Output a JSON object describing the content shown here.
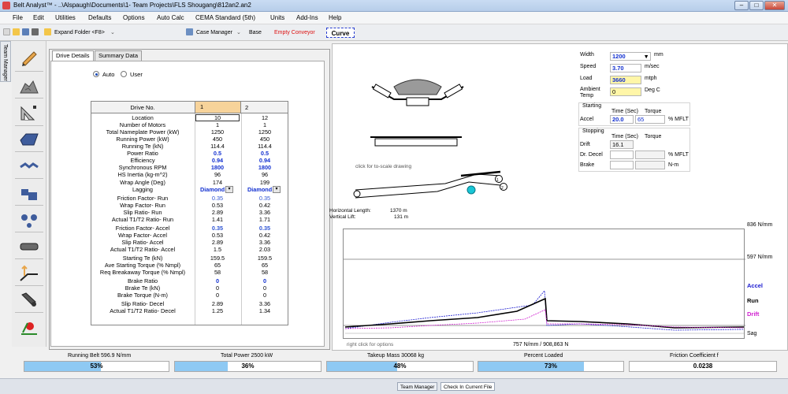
{
  "window": {
    "title": "Belt Analyst™ - ..\\Alspaugh\\Documents\\1- Team Projects\\FLS Shougang\\812an2.an2"
  },
  "menu": [
    "File",
    "Edit",
    "Utilities",
    "Defaults",
    "Options",
    "Auto Calc",
    "CEMA Standard (5th)",
    "Units",
    "Add-Ins",
    "Help"
  ],
  "toolbar": {
    "expand_folder": "Expand Folder <F8>",
    "case_manager": "Case Manager",
    "base": "Base",
    "empty_conveyor": "Empty Conveyor",
    "curve": "Curve"
  },
  "sidetab": "Team Manager",
  "left_icons": [
    "pencil-icon",
    "rock-pile-icon",
    "ruler-icon",
    "hopper-icon",
    "belt-link-icon",
    "pipe-icon",
    "pulley-set-icon",
    "roller-icon",
    "take-up-icon",
    "brake-icon",
    "alarm-icon"
  ],
  "tabs": {
    "drive_details": "Drive Details",
    "summary_data": "Summary Data"
  },
  "mode": {
    "auto": "Auto",
    "user": "User"
  },
  "drive_table": {
    "header": "Drive No.",
    "col1": "1",
    "col2": "2",
    "rows": [
      {
        "label": "Location",
        "v1": "10",
        "v2": "12"
      },
      {
        "label": "Number of Motors",
        "v1": "1",
        "v2": "1"
      },
      {
        "label": "Total Nameplate Power (kW)",
        "v1": "1250",
        "v2": "1250"
      },
      {
        "label": "Running Power (kW)",
        "v1": "450",
        "v2": "450"
      },
      {
        "label": "Running Te (kN)",
        "v1": "114.4",
        "v2": "114.4"
      },
      {
        "label": "Power Ratio",
        "v1": "0.5",
        "v2": "0.5"
      },
      {
        "label": "Efficiency",
        "v1": "0.94",
        "v2": "0.94"
      },
      {
        "label": "Synchronous RPM",
        "v1": "1800",
        "v2": "1800"
      },
      {
        "label": "HS Inertia (kg-m^2)",
        "v1": "96",
        "v2": "96"
      },
      {
        "label": "Wrap Angle (Deg)",
        "v1": "174",
        "v2": "199"
      },
      {
        "label": "Lagging",
        "v1": "Diamond",
        "v2": "Diamond"
      },
      {
        "label": "Friction Factor- Run",
        "v1": "0.35",
        "v2": "0.35"
      },
      {
        "label": "Wrap Factor- Run",
        "v1": "0.53",
        "v2": "0.42"
      },
      {
        "label": "Slip Ratio- Run",
        "v1": "2.89",
        "v2": "3.36"
      },
      {
        "label": "Actual T1/T2 Ratio- Run",
        "v1": "1.41",
        "v2": "1.71"
      },
      {
        "label": "Friction Factor- Accel",
        "v1": "0.35",
        "v2": "0.35"
      },
      {
        "label": "Wrap Factor- Accel",
        "v1": "0.53",
        "v2": "0.42"
      },
      {
        "label": "Slip Ratio- Accel",
        "v1": "2.89",
        "v2": "3.36"
      },
      {
        "label": "Actual T1/T2 Ratio- Accel",
        "v1": "1.5",
        "v2": "2.03"
      },
      {
        "label": "Starting Te (kN)",
        "v1": "159.5",
        "v2": "159.5"
      },
      {
        "label": "Ave Starting Torque (% Nmpl)",
        "v1": "65",
        "v2": "65"
      },
      {
        "label": "Req Breakaway Torque (% Nmpl)",
        "v1": "58",
        "v2": "58"
      },
      {
        "label": "Brake Ratio",
        "v1": "0",
        "v2": "0"
      },
      {
        "label": "Brake Te (kN)",
        "v1": "0",
        "v2": "0"
      },
      {
        "label": "Brake Torque (N-m)",
        "v1": "0",
        "v2": "0"
      },
      {
        "label": "Slip Ratio- Decel",
        "v1": "2.89",
        "v2": "3.36"
      },
      {
        "label": "Actual T1/T2 Ratio- Decel",
        "v1": "1.25",
        "v2": "1.34"
      }
    ]
  },
  "params": {
    "width_label": "Width",
    "width_value": "1200",
    "width_unit": "mm",
    "speed_label": "Speed",
    "speed_value": "3.70",
    "speed_unit": "m/sec",
    "load_label": "Load",
    "load_value": "3660",
    "load_unit": "mtph",
    "ambient_label": "Ambient Temp",
    "ambient_value": "0",
    "ambient_unit": "Deg C"
  },
  "starting": {
    "title": "Starting",
    "time_header": "Time (Sec)",
    "torque_header": "Torque",
    "accel_label": "Accel",
    "accel_time": "20.0",
    "accel_torque": "65",
    "unit": "% MFLT"
  },
  "stopping": {
    "title": "Stopping",
    "time_header": "Time (Sec)",
    "torque_header": "Torque",
    "drift_label": "Drift",
    "drift_time": "16.1",
    "decel_label": "Dr. Decel",
    "decel_unit": "% MFLT",
    "brake_label": "Brake",
    "brake_unit": "N-m"
  },
  "drawing": {
    "hint": "click for to-scale drawing",
    "horizontal_length_label": "Horizontal Length:",
    "horizontal_length": "1370 m",
    "vertical_lift_label": "Vertical Lift:",
    "vertical_lift": "131 m"
  },
  "chart_data": {
    "type": "line",
    "series": [
      {
        "name": "Accel",
        "color": "#1a1ad0"
      },
      {
        "name": "Run",
        "color": "#000000"
      },
      {
        "name": "Drift",
        "color": "#d020d0"
      },
      {
        "name": "Sag",
        "color": "#555555"
      }
    ],
    "ref_lines": [
      "836 N/mm",
      "597 N/mm"
    ],
    "footer_left": "right click for options",
    "footer_mid": "757 N/mm  /  908,863 N"
  },
  "status": {
    "running_belt_label": "Running Belt 596.9 N/mm",
    "running_belt_pct": "53%",
    "running_belt_frac": 0.53,
    "total_power_label": "Total Power 2500 kW",
    "total_power_pct": "36%",
    "total_power_frac": 0.36,
    "takeup_label": "Takeup Mass 30068  kg",
    "takeup_pct": "48%",
    "takeup_frac": 0.48,
    "percent_loaded_label": "Percent Loaded",
    "percent_loaded_pct": "73%",
    "percent_loaded_frac": 0.73,
    "friction_label": "Friction Coefficient f",
    "friction_value": "0.0238"
  },
  "taskbar": {
    "team_manager": "Team Manager",
    "check_in": "Check In Current File"
  }
}
